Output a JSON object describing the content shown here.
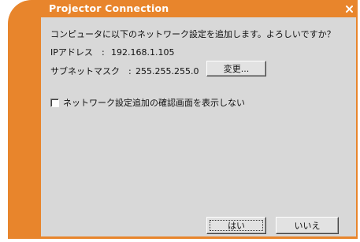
{
  "window": {
    "title": "Projector Connection",
    "close_glyph": "x"
  },
  "dialog": {
    "message": "コンピュータに以下のネットワーク設定を追加します。よろしいですか？",
    "ip_label": "IPアドレス",
    "ip_sep": ":",
    "ip_value": "192.168.1.105",
    "subnet_label": "サブネットマスク",
    "subnet_sep": ":",
    "subnet_value": "255.255.255.0",
    "change_button": "変更...",
    "checkbox_label": "ネットワーク設定追加の確認画面を表示しない",
    "checkbox_checked": false,
    "yes_button": "はい",
    "no_button": "いいえ"
  },
  "colors": {
    "frame": "#e8852c",
    "client": "#d8d8d8",
    "title_text": "#ffffff"
  }
}
